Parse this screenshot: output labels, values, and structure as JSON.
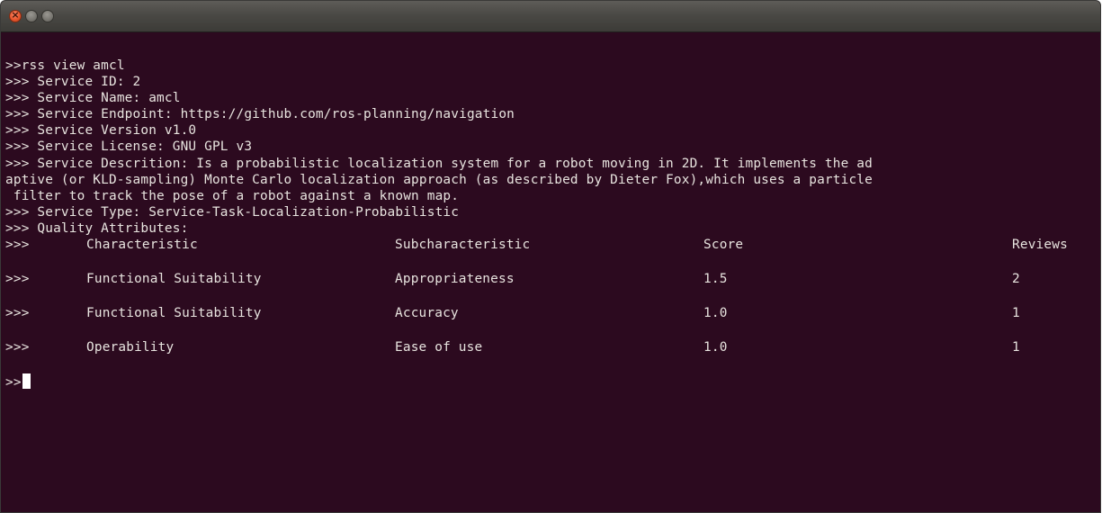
{
  "window": {
    "close_icon": "close-icon",
    "minimize_icon": "minimize-icon",
    "maximize_icon": "maximize-icon"
  },
  "terminal": {
    "lines": [
      ">>rss view amcl",
      ">>> Service ID: 2",
      ">>> Service Name: amcl",
      ">>> Service Endpoint: https://github.com/ros-planning/navigation",
      ">>> Service Version v1.0",
      ">>> Service License: GNU GPL v3",
      ">>> Service Descrition: Is a probabilistic localization system for a robot moving in 2D. It implements the ad",
      "aptive (or KLD-sampling) Monte Carlo localization approach (as described by Dieter Fox),which uses a particle",
      " filter to track the pose of a robot against a known map.",
      ">>> Service Type: Service-Task-Localization-Probabilistic",
      ">>> Quality Attributes:"
    ],
    "table": {
      "prompt": ">>>",
      "headers": [
        "Characteristic",
        "Subcharacteristic",
        "Score",
        "Reviews"
      ],
      "rows": [
        [
          "Functional Suitability",
          "Appropriateness",
          "1.5",
          "2"
        ],
        [
          "Functional Suitability",
          "Accuracy",
          "1.0",
          "1"
        ],
        [
          "Operability",
          "Ease of use",
          "1.0",
          "1"
        ]
      ]
    },
    "input_prompt": ">>",
    "input_value": ""
  },
  "colors": {
    "background": "#2c0a1f",
    "text": "#e8e4df",
    "titlebar": "#3c3b37"
  }
}
